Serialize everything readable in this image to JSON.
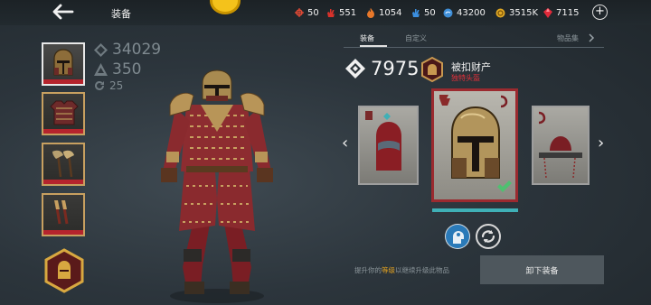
{
  "header": {
    "title": "装备",
    "resources": [
      {
        "icon": "red-cross-icon",
        "value": "50"
      },
      {
        "icon": "red-hand-icon",
        "value": "551"
      },
      {
        "icon": "orange-flame-icon",
        "value": "1054"
      },
      {
        "icon": "blue-hand-icon",
        "value": "50"
      },
      {
        "icon": "blue-coin-icon",
        "value": "43200"
      },
      {
        "icon": "gold-coin-icon",
        "value": "3515K"
      },
      {
        "icon": "ruby-icon",
        "value": "7115"
      }
    ]
  },
  "stats": {
    "power": "34029",
    "level": "350",
    "upgrades": "25"
  },
  "tabs": [
    {
      "label": "装备"
    },
    {
      "label": "自定义"
    },
    {
      "label": "物品集"
    }
  ],
  "item": {
    "power": "7975",
    "name": "被扣财产",
    "subtitle": "独特头盔",
    "upgrade_progress": 1.0
  },
  "footer": {
    "hint_prefix": "提升你的",
    "hint_highlight": "等级",
    "hint_suffix": "以继续升级此物品",
    "unequip_label": "卸下装备"
  },
  "colors": {
    "accent_red": "#b5242d",
    "accent_gold": "#c8a060",
    "progress_teal": "#3fb0b6"
  }
}
